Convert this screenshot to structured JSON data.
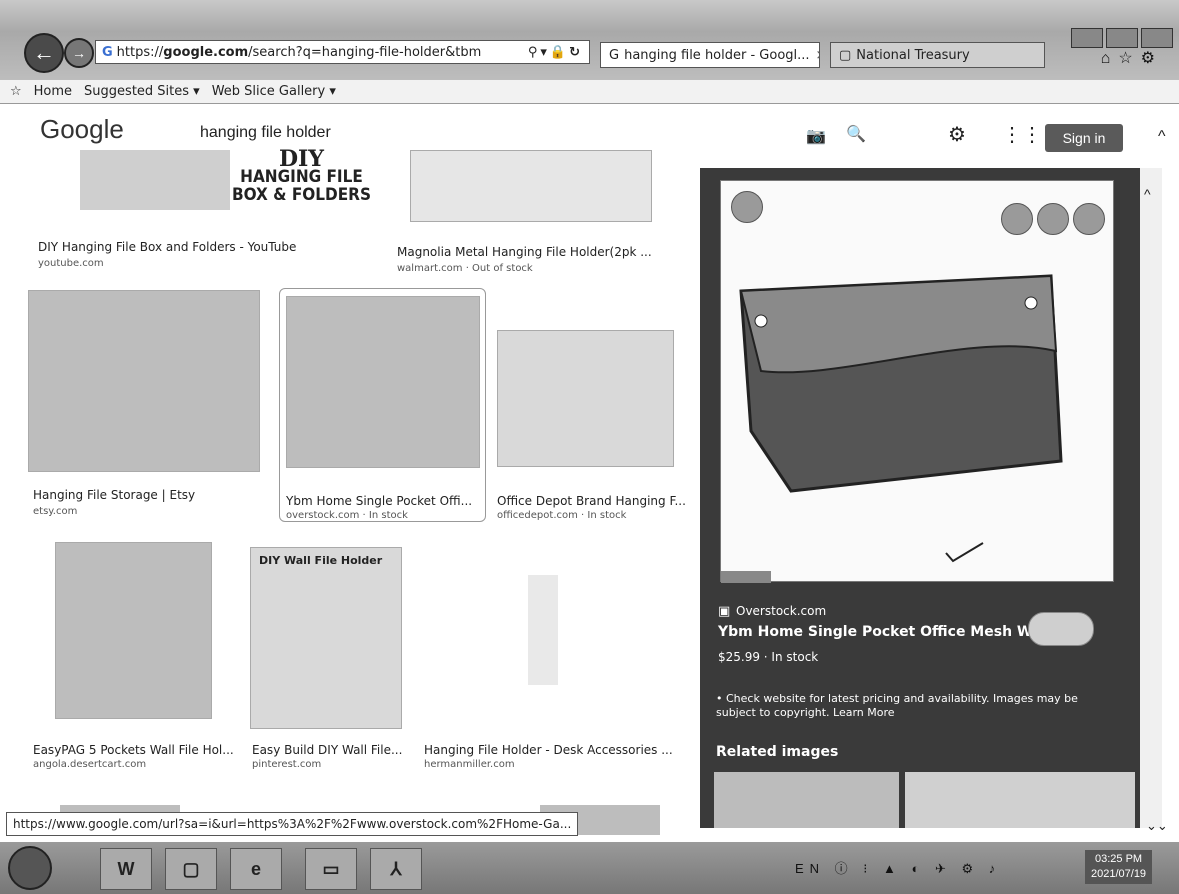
{
  "browser": {
    "url": "https://www.google.com/search?q=hanging-file-holder&tbm",
    "url_prefix": "https://",
    "url_domain": "google.com",
    "url_rest": "/search?q=hanging-file-holder&tbm",
    "tabs": [
      {
        "label": "hanging file holder - Googl...",
        "active": true
      },
      {
        "label": "National Treasury",
        "active": false
      }
    ],
    "favorites": [
      "Home",
      "Suggested Sites ▾",
      "Web Slice Gallery ▾"
    ]
  },
  "search": {
    "logo": "Google",
    "query": "hanging file holder",
    "signin_label": "Sign in"
  },
  "results": [
    {
      "title": "DIY Hanging File Box and Folders - YouTube",
      "source": "youtube.com"
    },
    {
      "title": "Magnolia Metal Hanging File Holder(2pk ...",
      "source": "walmart.com · Out of stock"
    },
    {
      "title": "Hanging File Storage | Etsy",
      "source": "etsy.com"
    },
    {
      "title": "Ybm Home Single Pocket Offi...",
      "source": "overstock.com · In stock"
    },
    {
      "title": "Office Depot Brand Hanging F...",
      "source": "officedepot.com · In stock"
    },
    {
      "title": "EasyPAG 5 Pockets Wall File Hol...",
      "source": "angola.desertcart.com"
    },
    {
      "title": "Easy Build DIY Wall File...",
      "source": "pinterest.com"
    },
    {
      "title": "Hanging File Holder - Desk Accessories ...",
      "source": "hermanmiller.com"
    }
  ],
  "thumb_text": {
    "diy_line1": "DIY",
    "diy_line2": "HANGING FILE",
    "diy_line3": "BOX & FOLDERS",
    "wall_holder": "DIY Wall File Holder"
  },
  "panel": {
    "source": "Overstock.com",
    "title": "Ybm Home Single Pocket Office Mesh Wal...",
    "price": "$25.99 · In stock",
    "disclaimer_line1": "• Check website for latest pricing and availability. Images may be",
    "disclaimer_line2": "subject to copyright. Learn More",
    "related": "Related images"
  },
  "status_url": "https://www.google.com/url?sa=i&url=https%3A%2F%2Fwww.overstock.com%2FHome-Ga...",
  "taskbar": {
    "lang": "EN",
    "time": "03:25 PM",
    "date": "2021/07/19"
  }
}
